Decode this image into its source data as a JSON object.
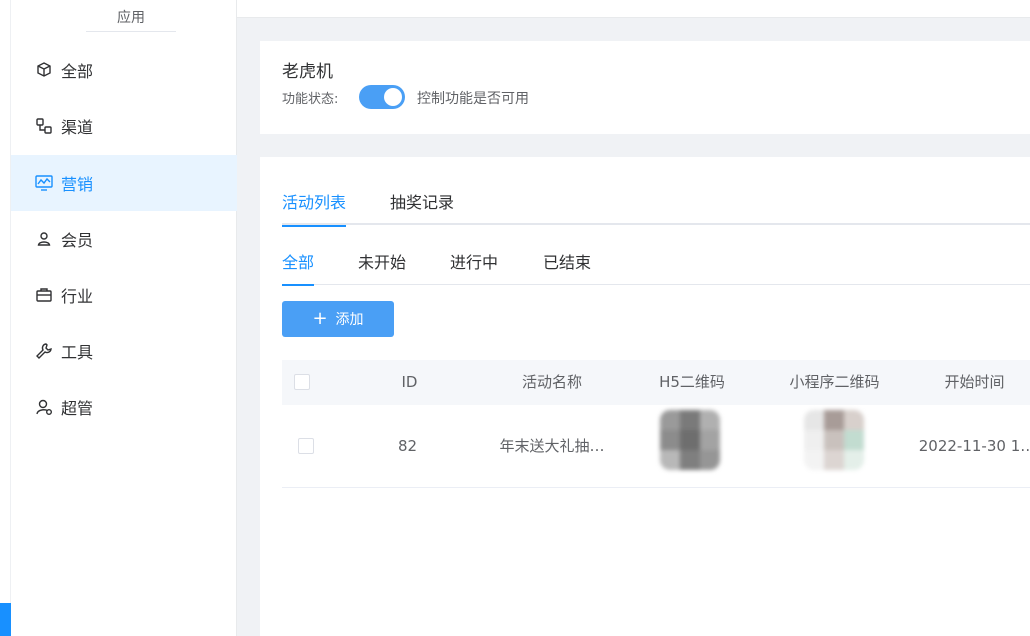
{
  "sidebar": {
    "header": "应用",
    "items": [
      {
        "label": "全部",
        "icon": "cube-icon"
      },
      {
        "label": "渠道",
        "icon": "channel-icon"
      },
      {
        "label": "营销",
        "icon": "marketing-chart-icon",
        "active": true
      },
      {
        "label": "会员",
        "icon": "user-icon"
      },
      {
        "label": "行业",
        "icon": "briefcase-icon"
      },
      {
        "label": "工具",
        "icon": "wrench-icon"
      },
      {
        "label": "超管",
        "icon": "admin-user-icon"
      }
    ]
  },
  "feature": {
    "title": "老虎机",
    "status_label": "功能状态:",
    "enabled": true,
    "status_desc": "控制功能是否可用"
  },
  "main_tabs": [
    "活动列表",
    "抽奖记录"
  ],
  "filter_tabs": [
    "全部",
    "未开始",
    "进行中",
    "已结束"
  ],
  "add_button": "添加",
  "table": {
    "headers": [
      "ID",
      "活动名称",
      "H5二维码",
      "小程序二维码",
      "开始时间"
    ],
    "rows": [
      {
        "id": "82",
        "name": "年末送大礼抽…",
        "start_time": "2022-11-30 1…"
      }
    ]
  },
  "colors": {
    "accent": "#1890ff",
    "button": "#4a9ff5",
    "active_bg": "#e8f4ff"
  }
}
